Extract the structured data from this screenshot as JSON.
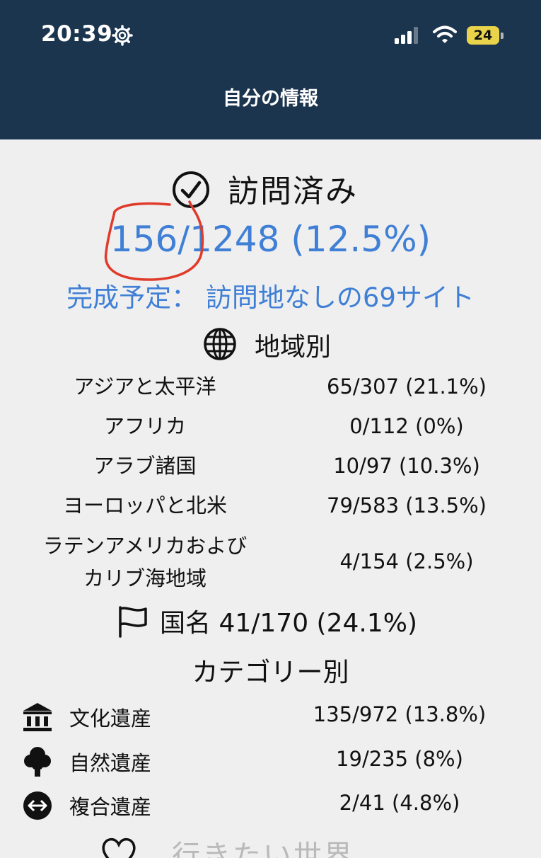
{
  "status_bar": {
    "time": "20:39",
    "battery": "24",
    "icons": [
      "gear-icon",
      "signal-icon",
      "wifi-icon",
      "battery-icon"
    ]
  },
  "nav": {
    "title": "自分の情報"
  },
  "visited": {
    "title": "訪問済み",
    "total": "156/1248 (12.5%)",
    "completion": "完成予定： 訪問地なしの69サイト",
    "accent_color": "#3f7fd6"
  },
  "regions": {
    "title": "地域別",
    "items": [
      {
        "label": "アジアと太平洋",
        "value": "65/307 (21.1%)"
      },
      {
        "label": "アフリカ",
        "value": "0/112 (0%)"
      },
      {
        "label": "アラブ諸国",
        "value": "10/97 (10.3%)"
      },
      {
        "label": "ヨーロッパと北米",
        "value": "79/583 (13.5%)"
      },
      {
        "label_line1": "ラテンアメリカおよび",
        "label_line2": "カリブ海地域",
        "value": "4/154 (2.5%)"
      }
    ]
  },
  "countries": {
    "text": "国名 41/170 (24.1%)"
  },
  "categories": {
    "title": "カテゴリー別",
    "items": [
      {
        "icon": "museum-icon",
        "label": "文化遺産",
        "value": "135/972 (13.8%)"
      },
      {
        "icon": "tree-icon",
        "label": "自然遺産",
        "value": "19/235 (8%)"
      },
      {
        "icon": "mixed-arrows-icon",
        "label": "複合遺産",
        "value": "2/41 (4.8%)"
      }
    ]
  },
  "wishlist": {
    "title": "行きたい世界"
  },
  "colors": {
    "header_bg": "#1c354e",
    "body_bg": "#efefef",
    "annotation": "#e03a2a"
  }
}
